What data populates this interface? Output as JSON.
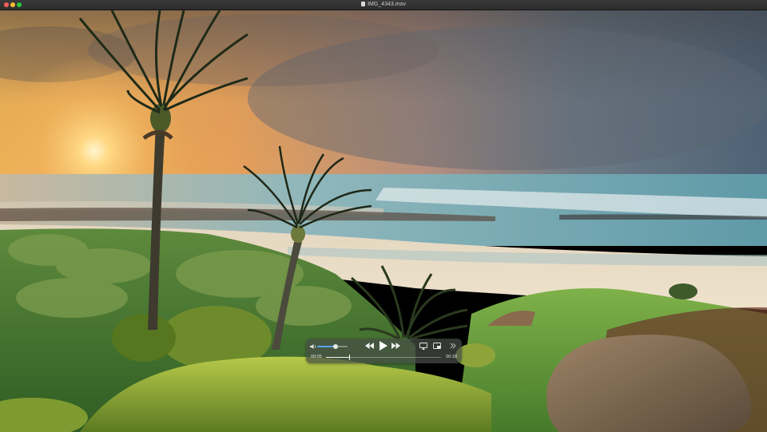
{
  "window": {
    "title": "IMG_4343.mov",
    "buttons": [
      "close",
      "minimize",
      "zoom"
    ]
  },
  "colors": {
    "close": "#ff5f57",
    "minimize": "#febc2e",
    "zoom": "#28c840",
    "volume_accent": "#5aa0ff"
  },
  "video": {
    "description_icons": [
      "sunset-sky",
      "palm-trees",
      "ocean",
      "beach",
      "grass",
      "rock"
    ]
  },
  "controls": {
    "volume_level": 0.6,
    "elapsed": "00:05",
    "remaining": "00:18",
    "progress": 0.2,
    "icons": {
      "volume": "speaker-icon",
      "rewind": "rewind-icon",
      "play": "play-icon",
      "forward": "fast-forward-icon",
      "airplay": "airplay-icon",
      "pip": "picture-in-picture-icon",
      "more": "chevron-right-icon"
    }
  }
}
